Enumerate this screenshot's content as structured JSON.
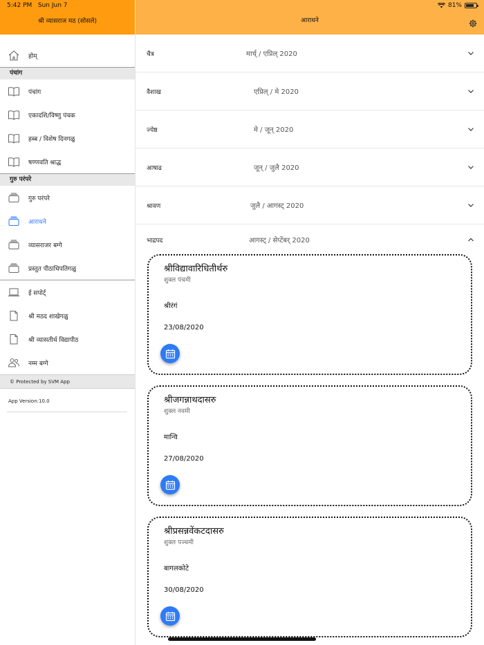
{
  "status": {
    "time": "5:42 PM",
    "date": "Sun Jun 7",
    "battery": "81%",
    "battery_level": 0.81
  },
  "sidebar": {
    "title": "श्री व्यासराज मठ (सोसले)",
    "home": "होम्",
    "section_panchang": "पंचांग",
    "panchang_items": [
      {
        "label": "पंचांग",
        "icon": "book-icon"
      },
      {
        "label": "एकादशि/विष्णु पंचक",
        "icon": "book-icon"
      },
      {
        "label": "हब्ब / विशेष दिनगळु",
        "icon": "book-icon"
      },
      {
        "label": "षण्णवति श्राद्ध",
        "icon": "book-icon"
      }
    ],
    "section_guru": "गुरु परंपरे",
    "guru_items": [
      {
        "label": "गुरु परंपरे",
        "icon": "stack-icon"
      },
      {
        "label": "आराधने",
        "icon": "stack-icon",
        "active": true
      },
      {
        "label": "व्यासराजर बग्गे",
        "icon": "stack-icon"
      },
      {
        "label": "प्रस्तुत पीठाधिपतिगळु",
        "icon": "stack-icon"
      }
    ],
    "other_items": [
      {
        "label": "ई सपोर्ट्",
        "icon": "laptop-icon"
      },
      {
        "label": "श्री मठद शाखेगळु",
        "icon": "document-icon"
      },
      {
        "label": "श्री व्यासतीर्थ विद्यापीठ",
        "icon": "document-icon"
      },
      {
        "label": "नम्म बग्गे",
        "icon": "people-icon"
      }
    ],
    "protected": "© Protected by SVM App",
    "version": "App Version:10.0"
  },
  "main": {
    "title": "आराधने",
    "months": [
      {
        "name": "चैत्र",
        "range": "मार्च् / एप्रिल् 2020"
      },
      {
        "name": "वैशाख",
        "range": "एप्रिल् / मे 2020"
      },
      {
        "name": "ज्येष्ठ",
        "range": "मे / जून् 2020"
      },
      {
        "name": "आषाढ",
        "range": "जून् / जुलै 2020"
      },
      {
        "name": "श्रावण",
        "range": "जुलै / आगस्ट् 2020"
      },
      {
        "name": "भाद्रपद",
        "range": "आगस्ट् / सेप्टेंबर् 2020"
      }
    ],
    "cards": [
      {
        "name": "श्रीविद्यावारिधितीर्थरु",
        "tithi": "शुक्ल पंचमी",
        "place": "श्रीरंगं",
        "date": "23/08/2020"
      },
      {
        "name": "श्रीजगन्नाथदासरु",
        "tithi": "शुक्ल नवमी",
        "place": "मान्वि",
        "date": "27/08/2020"
      },
      {
        "name": "श्रीप्रसन्नवेंकटदासरु",
        "tithi": "शुक्ल पञ्चमी",
        "place": "बागलकोटे",
        "date": "30/08/2020"
      }
    ]
  },
  "colors": {
    "sidebar_header": "#fe9b0e",
    "main_header": "#fdb147",
    "accent": "#2e7bf6"
  }
}
